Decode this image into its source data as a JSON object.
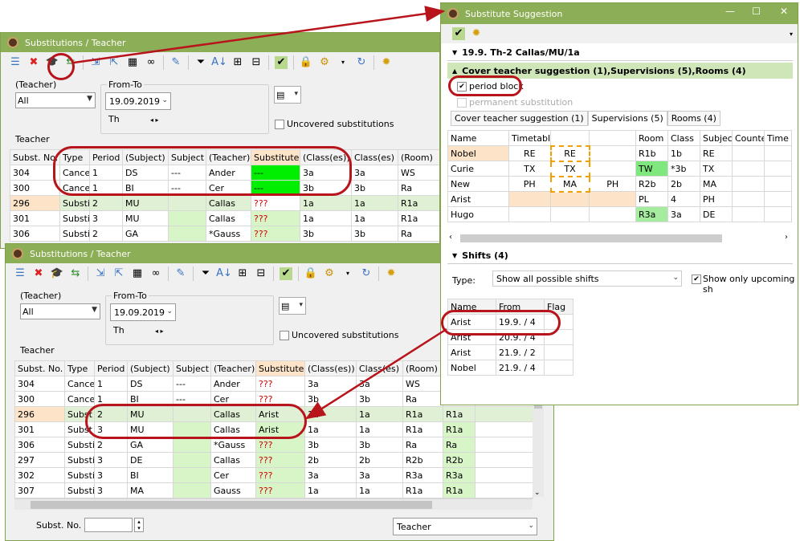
{
  "win_top": {
    "title": "Substitutions / Teacher",
    "teacher_label": "(Teacher)",
    "teacher_value": "All",
    "fromto_label": "From-To",
    "date": "19.09.2019",
    "day": "Th",
    "uncovered_label": "Uncovered substitutions",
    "section_label": "Teacher",
    "columns": [
      "Subst. No.",
      "Type",
      "Period",
      "(Subject)",
      "Subject",
      "(Teacher)",
      "Substitute",
      "(Class(es))",
      "Class(es)",
      "(Room)"
    ],
    "rows": [
      {
        "no": "304",
        "type": "Cance",
        "period": "1",
        "subj1": "DS",
        "subj2": "---",
        "teacher": "Ander",
        "subst": "---",
        "cls1": "3a",
        "cls2": "3a",
        "room": "WS"
      },
      {
        "no": "300",
        "type": "Cance",
        "period": "1",
        "subj1": "BI",
        "subj2": "---",
        "teacher": "Cer",
        "subst": "---",
        "cls1": "3b",
        "cls2": "3b",
        "room": "Ra"
      },
      {
        "no": "296",
        "type": "Substi",
        "period": "2",
        "subj1": "MU",
        "subj2": "",
        "teacher": "Callas",
        "subst": "???",
        "cls1": "1a",
        "cls2": "1a",
        "room": "R1a"
      },
      {
        "no": "301",
        "type": "Substi",
        "period": "3",
        "subj1": "MU",
        "subj2": "",
        "teacher": "Callas",
        "subst": "???",
        "cls1": "1a",
        "cls2": "1a",
        "room": "R1a"
      },
      {
        "no": "306",
        "type": "Substi",
        "period": "2",
        "subj1": "GA",
        "subj2": "",
        "teacher": "*Gauss",
        "subst": "???",
        "cls1": "3b",
        "cls2": "3b",
        "room": "Ra"
      }
    ]
  },
  "win_bottom": {
    "title": "Substitutions / Teacher",
    "teacher_label": "(Teacher)",
    "teacher_value": "All",
    "fromto_label": "From-To",
    "date": "19.09.2019",
    "day": "Th",
    "uncovered_label": "Uncovered substitutions",
    "section_label": "Teacher",
    "columns": [
      "Subst. No.",
      "Type",
      "Period",
      "(Subject)",
      "Subject",
      "(Teacher)",
      "Substitute",
      "(Class(es))",
      "Class(es)",
      "(Room)",
      "",
      ""
    ],
    "rows": [
      {
        "no": "304",
        "type": "Cance",
        "period": "1",
        "subj1": "DS",
        "subj2": "---",
        "teacher": "Ander",
        "subst": "???",
        "cls1": "3a",
        "cls2": "3a",
        "room": "WS",
        "room2": ""
      },
      {
        "no": "300",
        "type": "Cance",
        "period": "1",
        "subj1": "BI",
        "subj2": "---",
        "teacher": "Cer",
        "subst": "???",
        "cls1": "3b",
        "cls2": "3b",
        "room": "Ra",
        "room2": ""
      },
      {
        "no": "296",
        "type": "Subst",
        "period": "2",
        "subj1": "MU",
        "subj2": "",
        "teacher": "Callas",
        "subst": "Arist",
        "cls1": "1a",
        "cls2": "1a",
        "room": "R1a",
        "room2": "R1a"
      },
      {
        "no": "301",
        "type": "Subst",
        "period": "3",
        "subj1": "MU",
        "subj2": "",
        "teacher": "Callas",
        "subst": "Arist",
        "cls1": "1a",
        "cls2": "1a",
        "room": "R1a",
        "room2": "R1a"
      },
      {
        "no": "306",
        "type": "Substi",
        "period": "2",
        "subj1": "GA",
        "subj2": "",
        "teacher": "*Gauss",
        "subst": "???",
        "cls1": "3b",
        "cls2": "3b",
        "room": "Ra",
        "room2": "Ra"
      },
      {
        "no": "297",
        "type": "Substi",
        "period": "3",
        "subj1": "DE",
        "subj2": "",
        "teacher": "Callas",
        "subst": "???",
        "cls1": "2b",
        "cls2": "2b",
        "room": "R2b",
        "room2": "R2b"
      },
      {
        "no": "302",
        "type": "Substi",
        "period": "3",
        "subj1": "BI",
        "subj2": "",
        "teacher": "Cer",
        "subst": "???",
        "cls1": "3a",
        "cls2": "3a",
        "room": "R3a",
        "room2": "R3a"
      },
      {
        "no": "307",
        "type": "Substi",
        "period": "3",
        "subj1": "MA",
        "subj2": "",
        "teacher": "Gauss",
        "subst": "???",
        "cls1": "1a",
        "cls2": "1a",
        "room": "R1a",
        "room2": "R1a"
      }
    ],
    "footer_label": "Subst. No.",
    "footer_combo": "Teacher"
  },
  "suggestion": {
    "title": "Substitute Suggestion",
    "header": "19.9.  Th-2 Callas/MU/1a",
    "cover_section": "Cover teacher suggestion (1),Supervisions (5),Rooms (4)",
    "period_block": "period block",
    "permanent": "permanent substitution",
    "tabs": [
      "Cover teacher suggestion (1)",
      "Supervisions (5)",
      "Rooms (4)"
    ],
    "columns": [
      "Name",
      "Timetable",
      "",
      "",
      "Room",
      "Class",
      "Subject",
      "Counter",
      "Time"
    ],
    "rows": [
      {
        "name": "Nobel",
        "t1": "RE",
        "t2": "RE",
        "t3": "",
        "room": "R1b",
        "cls": "1b",
        "subj": "RE"
      },
      {
        "name": "Curie",
        "t1": "TX",
        "t2": "TX",
        "t3": "",
        "room": "TW",
        "cls": "*3b",
        "subj": "TX"
      },
      {
        "name": "New",
        "t1": "PH",
        "t2": "MA",
        "t3": "PH",
        "room": "R2b",
        "cls": "2b",
        "subj": "MA"
      },
      {
        "name": "Arist",
        "t1": "",
        "t2": "",
        "t3": "",
        "room": "PL",
        "cls": "4",
        "subj": "PH"
      },
      {
        "name": "Hugo",
        "t1": "",
        "t2": "",
        "t3": "",
        "room": "R3a",
        "cls": "3a",
        "subj": "DE"
      }
    ],
    "shifts_section": "Shifts (4)",
    "type_label": "Type:",
    "type_value": "Show all possible shifts",
    "upcoming_label": "Show only upcoming sh",
    "shift_columns": [
      "Name",
      "From",
      "Flag"
    ],
    "shifts": [
      {
        "name": "Arist",
        "from": "19.9. / 4"
      },
      {
        "name": "Arist",
        "from": "20.9. / 4"
      },
      {
        "name": "Arist",
        "from": "21.9. / 2"
      },
      {
        "name": "Nobel",
        "from": "21.9. / 4"
      }
    ]
  },
  "colors": {
    "accent_green": "#8cae56",
    "annotation_red": "#b8141b",
    "cell_green": "#00ee00",
    "light_green": "#d8f5c8"
  }
}
